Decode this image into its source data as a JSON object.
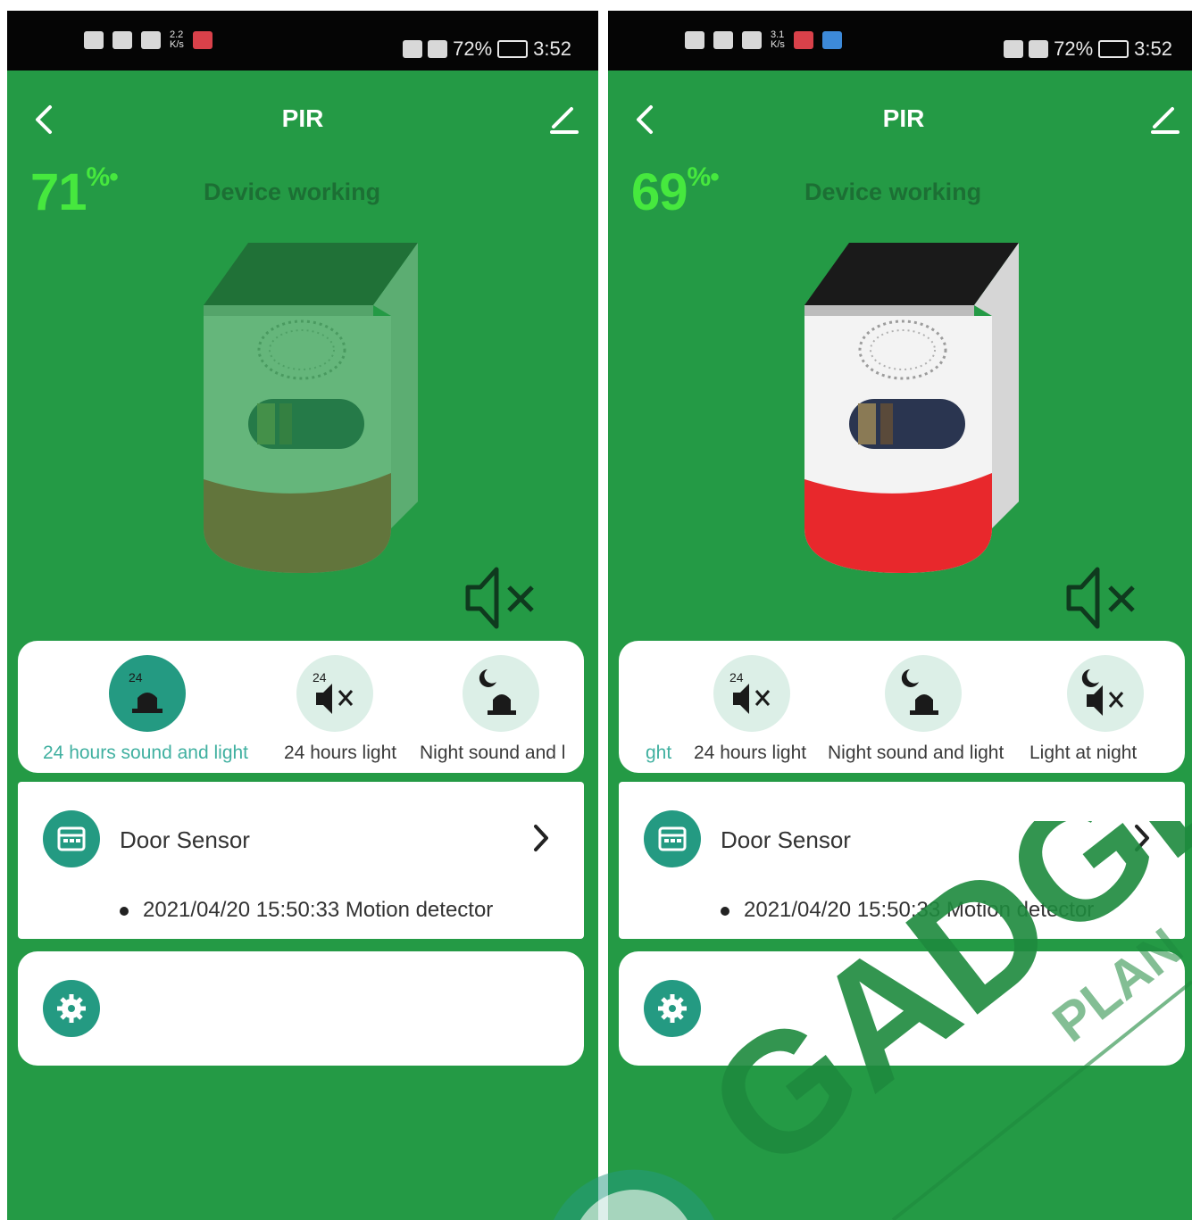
{
  "colors": {
    "background_green": "#249a45",
    "battery_text_green": "#46e83e",
    "status_text_dark_green": "#1c6f34",
    "accent_teal": "#249a82",
    "active_label_teal": "#40b0a0",
    "card_white": "#ffffff",
    "siren_red": "#e8282c",
    "watermark_green": "#1e8a3e"
  },
  "screens": [
    {
      "status_bar": {
        "network_speed": "2.2\nK/s",
        "battery_percent": "72%",
        "time": "3:52"
      },
      "header": {
        "title": "PIR",
        "back_icon": "chevron-left-icon",
        "edit_icon": "pencil-icon"
      },
      "battery_level": "71",
      "device_status": "Device working",
      "device_image_state": "faded-green-tint",
      "mute_icon": "speaker-muted-icon",
      "modes": [
        {
          "label": "24 hours sound and light",
          "icon": "siren-24h-icon",
          "active": true
        },
        {
          "label": "24 hours light",
          "icon": "mute-24h-icon",
          "active": false
        },
        {
          "label": "Night sound and l",
          "icon": "siren-night-icon",
          "active": false
        }
      ],
      "sensor": {
        "name": "Door Sensor",
        "icon": "calendar-icon",
        "event": "2021/04/20 15:50:33 Motion detector"
      },
      "settings": {
        "icon": "gear-icon"
      }
    },
    {
      "status_bar": {
        "network_speed": "3.1\nK/s",
        "battery_percent": "72%",
        "time": "3:52"
      },
      "header": {
        "title": "PIR",
        "back_icon": "chevron-left-icon",
        "edit_icon": "pencil-icon"
      },
      "battery_level": "69",
      "device_status": "Device working",
      "device_image_state": "full-color",
      "mute_icon": "speaker-muted-icon",
      "modes": [
        {
          "label": "ght",
          "icon": "",
          "active": true
        },
        {
          "label": "24 hours light",
          "icon": "mute-24h-icon",
          "active": false
        },
        {
          "label": "Night sound and light",
          "icon": "siren-night-icon",
          "active": false
        },
        {
          "label": "Light at night",
          "icon": "mute-night-icon",
          "active": false
        }
      ],
      "sensor": {
        "name": "Door Sensor",
        "icon": "calendar-icon",
        "event": "2021/04/20 15:50:33 Motion detector"
      },
      "settings": {
        "icon": "gear-icon"
      }
    }
  ],
  "watermark": {
    "text": "GADGET",
    "subtext": "PLAN"
  }
}
